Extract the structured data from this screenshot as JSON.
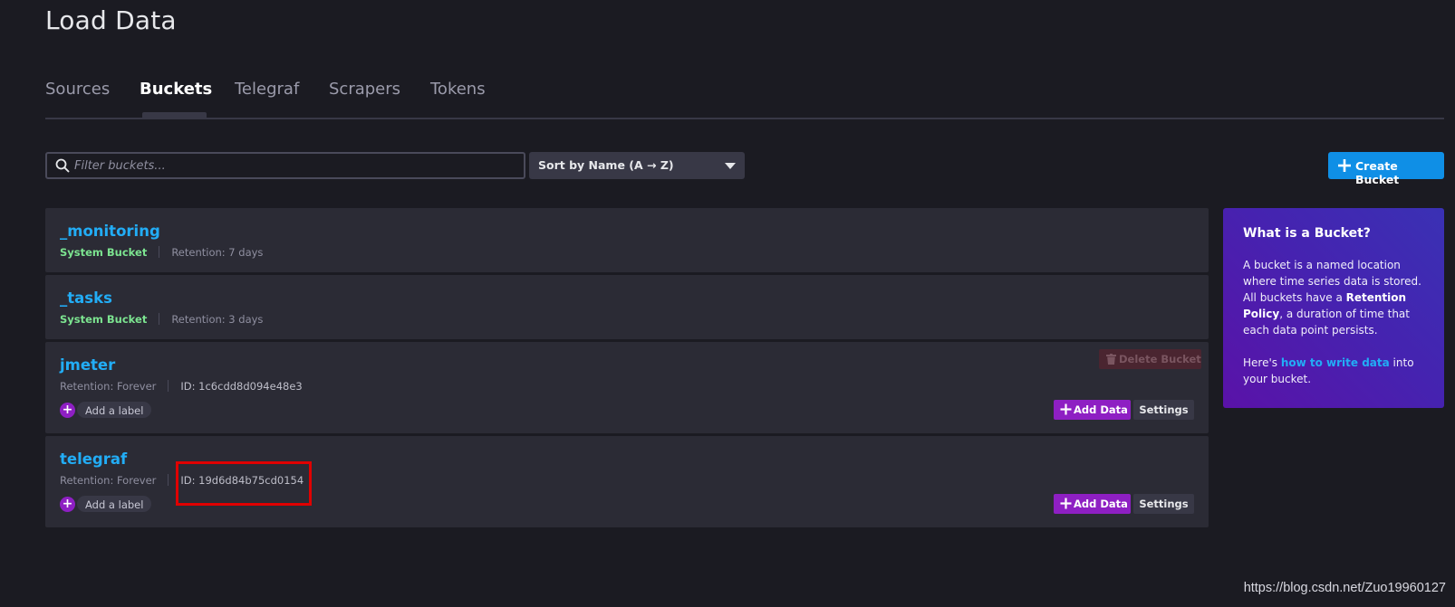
{
  "page": {
    "title": "Load Data"
  },
  "tabs": [
    {
      "label": "Sources"
    },
    {
      "label": "Buckets",
      "active": true
    },
    {
      "label": "Telegraf"
    },
    {
      "label": "Scrapers"
    },
    {
      "label": "Tokens"
    }
  ],
  "toolbar": {
    "filter_placeholder": "Filter buckets...",
    "sort_value": "Sort by Name (A → Z)",
    "create_label": "Create Bucket"
  },
  "buckets": [
    {
      "name": "_monitoring",
      "type_label": "System Bucket",
      "retention": "Retention: 7 days"
    },
    {
      "name": "_tasks",
      "type_label": "System Bucket",
      "retention": "Retention: 3 days"
    },
    {
      "name": "jmeter",
      "retention": "Retention: Forever",
      "id": "ID: 1c6cdd8d094e48e3",
      "add_label": "Add a label",
      "add_data_label": "Add Data",
      "settings_label": "Settings",
      "delete_label": "Delete Bucket"
    },
    {
      "name": "telegraf",
      "retention": "Retention: Forever",
      "id": "ID: 19d6d84b75cd0154",
      "add_label": "Add a label",
      "add_data_label": "Add Data",
      "settings_label": "Settings"
    }
  ],
  "info_panel": {
    "title": "What is a Bucket?",
    "p1_a": "A bucket is a named location where time series data is stored. All buckets have a ",
    "p1_bold": "Retention Policy",
    "p1_b": ", a duration of time that each data point persists.",
    "p2_a": "Here's ",
    "p2_link": "how to write data",
    "p2_b": " into your bucket."
  },
  "watermark": "https://blog.csdn.net/Zuo19960127",
  "colors": {
    "background": "#1b1b22",
    "card": "#2b2b35",
    "link": "#22adf6",
    "system_bucket": "#7ce490",
    "primary_button": "#0f8fe6",
    "add_data": "#8e1fc3",
    "highlight": "#e00000"
  }
}
